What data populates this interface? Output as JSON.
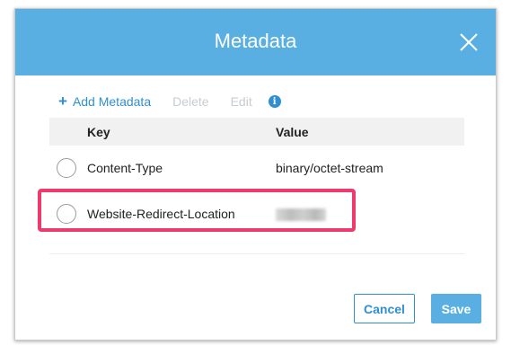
{
  "dialog": {
    "title": "Metadata"
  },
  "toolbar": {
    "add_icon": "+",
    "add_label": "Add Metadata",
    "delete_label": "Delete",
    "edit_label": "Edit",
    "info_glyph": "i"
  },
  "table": {
    "columns": [
      "Key",
      "Value"
    ],
    "rows": [
      {
        "key": "Content-Type",
        "value": "binary/octet-stream",
        "selected": false
      },
      {
        "key": "Website-Redirect-Location",
        "value": "",
        "value_obscured": true,
        "selected": false
      }
    ]
  },
  "footer": {
    "cancel_label": "Cancel",
    "save_label": "Save"
  },
  "colors": {
    "header_bg": "#59afe1",
    "accent": "#2f8fd0",
    "disabled": "#c7ccd1",
    "highlight_border": "#ee3a6d"
  },
  "icons": {
    "close": "close-icon",
    "add": "plus-icon",
    "info": "info-icon",
    "radio": "radio-icon"
  }
}
